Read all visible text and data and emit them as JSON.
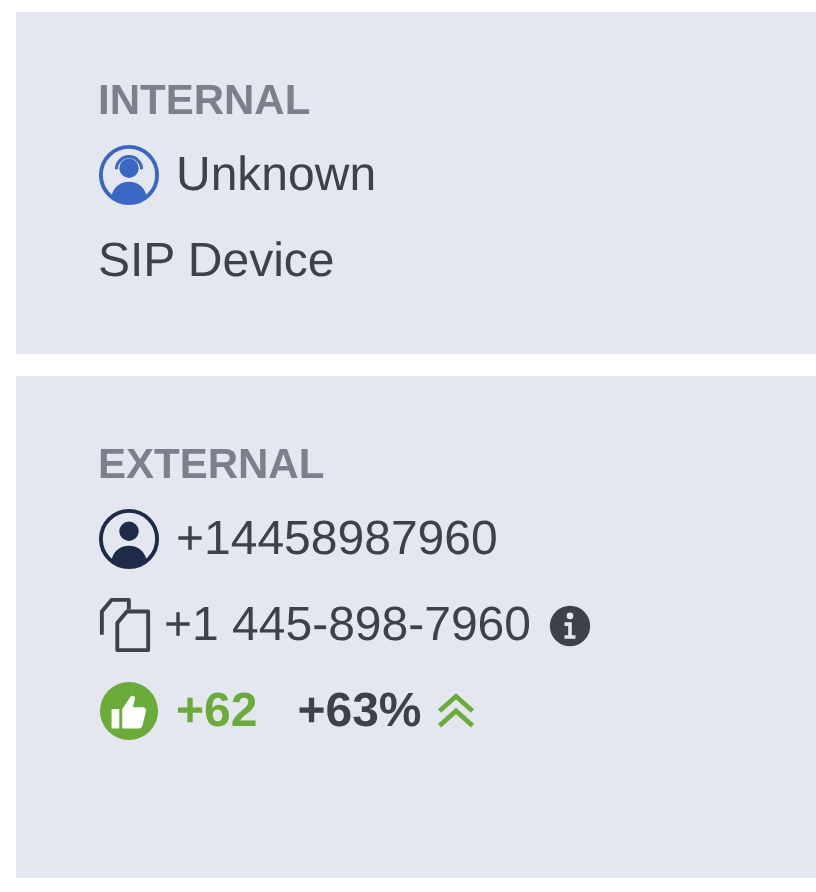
{
  "internal": {
    "heading": "INTERNAL",
    "name": "Unknown",
    "device": "SIP Device"
  },
  "external": {
    "heading": "EXTERNAL",
    "number": "+14458987960",
    "formatted": "+1 445-898-7960",
    "score": "+62",
    "change": "+63%",
    "rising": true
  }
}
